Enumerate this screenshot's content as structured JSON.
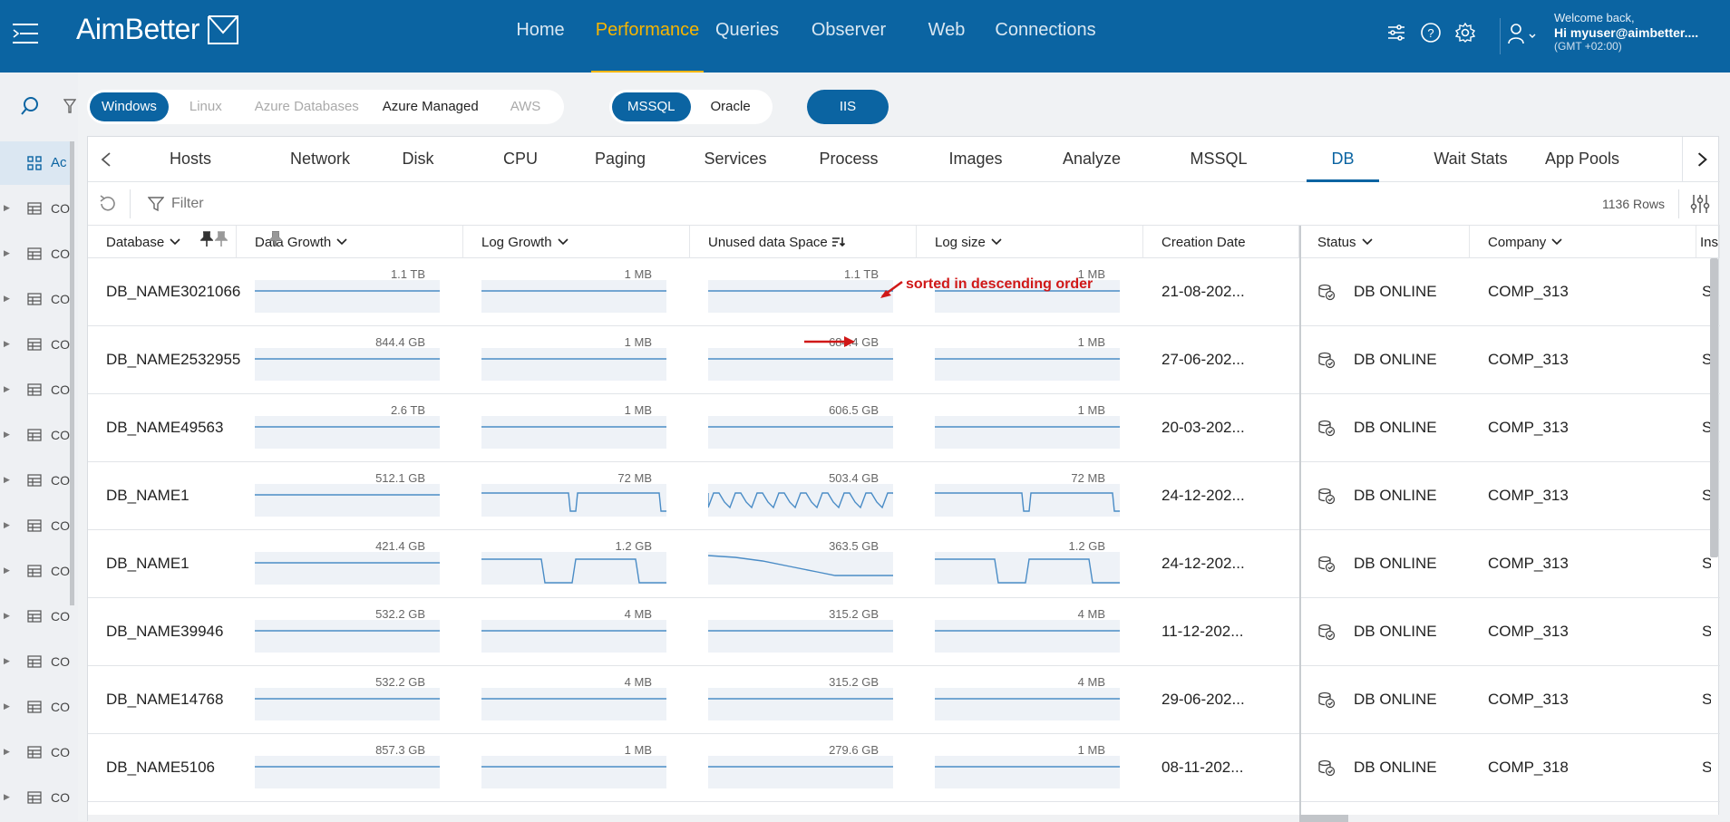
{
  "app": {
    "logo": "AimBetter",
    "nav": [
      "Home",
      "Performance",
      "Queries",
      "Observer",
      "Web",
      "Connections"
    ],
    "nav_active": "Performance",
    "user": {
      "welcome": "Welcome back,",
      "name": "Hi myuser@aimbetter....",
      "tz": "(GMT +02:00)"
    }
  },
  "sidebar": {
    "active_label": "Ac",
    "rows_label": "CO"
  },
  "platforms": [
    "Windows",
    "Linux",
    "Azure Databases",
    "Azure Managed",
    "AWS"
  ],
  "db_types": [
    "MSSQL",
    "Oracle"
  ],
  "web": [
    "IIS"
  ],
  "tabs": [
    "Hosts",
    "Network",
    "Disk",
    "CPU",
    "Paging",
    "Services",
    "Process",
    "Images",
    "Analyze",
    "MSSQL",
    "DB",
    "Wait Stats",
    "App Pools"
  ],
  "active_tab": "DB",
  "toolbar": {
    "filter_placeholder": "Filter",
    "rows": "1136 Rows"
  },
  "columns": [
    "Database",
    "Data Growth",
    "Log Growth",
    "Unused data Space",
    "Log size",
    "Creation Date",
    "Status",
    "Company",
    "Ins"
  ],
  "annotation": "sorted in descending order",
  "rows": [
    {
      "db": "DB_NAME3021066",
      "data": "1.1 TB",
      "log": "1 MB",
      "unused": "1.1 TB",
      "logsize": "1 MB",
      "date": "21-08-202...",
      "status": "DB ONLINE",
      "company": "COMP_313",
      "ins": "S"
    },
    {
      "db": "DB_NAME2532955",
      "data": "844.4 GB",
      "log": "1 MB",
      "unused": "684.4 GB",
      "logsize": "1 MB",
      "date": "27-06-202...",
      "status": "DB ONLINE",
      "company": "COMP_313",
      "ins": "S"
    },
    {
      "db": "DB_NAME49563",
      "data": "2.6 TB",
      "log": "1 MB",
      "unused": "606.5 GB",
      "logsize": "1 MB",
      "date": "20-03-202...",
      "status": "DB ONLINE",
      "company": "COMP_313",
      "ins": "S"
    },
    {
      "db": "DB_NAME1",
      "data": "512.1 GB",
      "log": "72 MB",
      "unused": "503.4 GB",
      "logsize": "72 MB",
      "date": "24-12-202...",
      "status": "DB ONLINE",
      "company": "COMP_313",
      "ins": "S"
    },
    {
      "db": "DB_NAME1",
      "data": "421.4 GB",
      "log": "1.2 GB",
      "unused": "363.5 GB",
      "logsize": "1.2 GB",
      "date": "24-12-202...",
      "status": "DB ONLINE",
      "company": "COMP_313",
      "ins": "S"
    },
    {
      "db": "DB_NAME39946",
      "data": "532.2 GB",
      "log": "4 MB",
      "unused": "315.2 GB",
      "logsize": "4 MB",
      "date": "11-12-202...",
      "status": "DB ONLINE",
      "company": "COMP_313",
      "ins": "S"
    },
    {
      "db": "DB_NAME14768",
      "data": "532.2 GB",
      "log": "4 MB",
      "unused": "315.2 GB",
      "logsize": "4 MB",
      "date": "29-06-202...",
      "status": "DB ONLINE",
      "company": "COMP_313",
      "ins": "S"
    },
    {
      "db": "DB_NAME5106",
      "data": "857.3 GB",
      "log": "1 MB",
      "unused": "279.6 GB",
      "logsize": "1 MB",
      "date": "08-11-202...",
      "status": "DB ONLINE",
      "company": "COMP_318",
      "ins": "S"
    }
  ],
  "colors": {
    "brand": "#0b64a2",
    "accent": "#f7b500",
    "annotation": "#d01818",
    "spark": "#4a8cc6",
    "spark_fill": "#eef2f7"
  }
}
